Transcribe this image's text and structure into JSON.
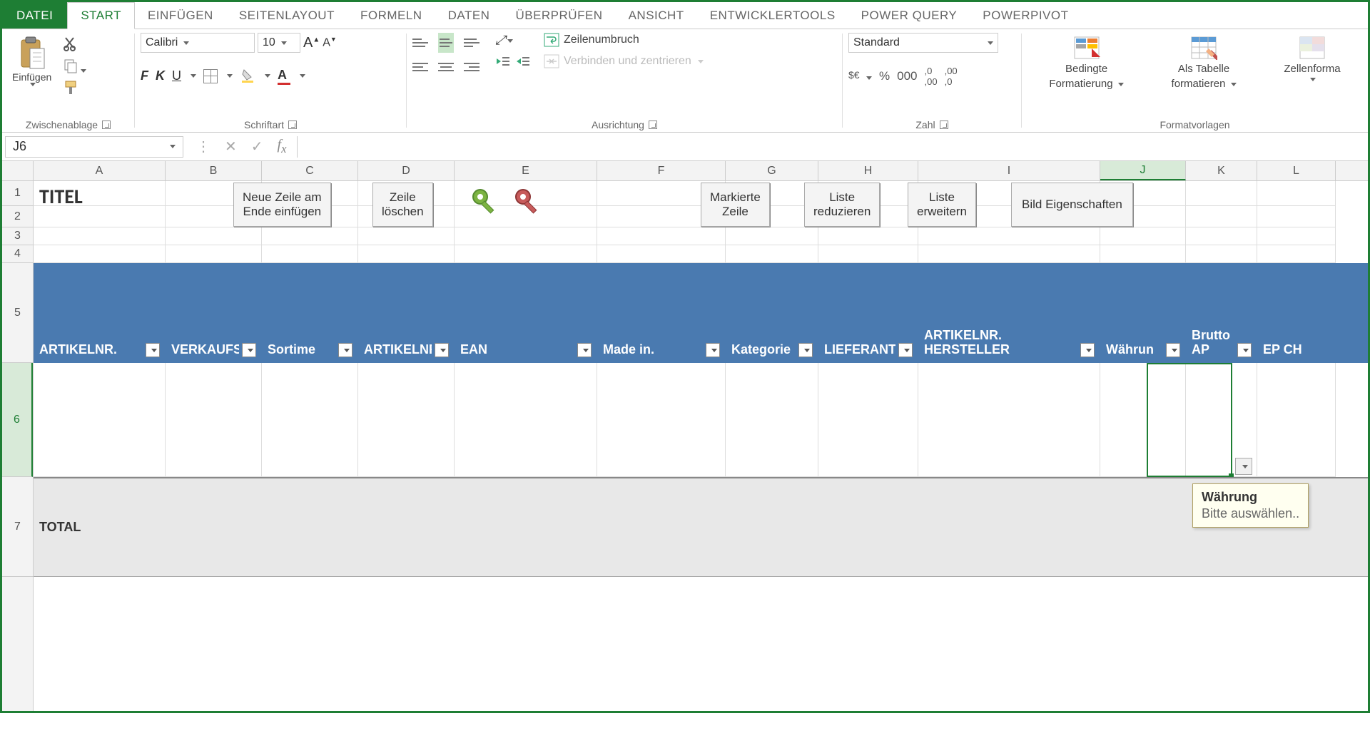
{
  "tabs": {
    "file": "DATEI",
    "start": "START",
    "insert": "EINFÜGEN",
    "layout": "SEITENLAYOUT",
    "formulas": "FORMELN",
    "data": "DATEN",
    "review": "ÜBERPRÜFEN",
    "view": "ANSICHT",
    "dev": "ENTWICKLERTOOLS",
    "pq": "POWER QUERY",
    "pp": "POWERPIVOT"
  },
  "ribbon": {
    "clipboard": {
      "paste": "Einfügen",
      "label": "Zwischenablage"
    },
    "font": {
      "name": "Calibri",
      "size": "10",
      "bold": "F",
      "italic": "K",
      "underline": "U",
      "label": "Schriftart"
    },
    "align": {
      "wrap": "Zeilenumbruch",
      "merge": "Verbinden und zentrieren",
      "label": "Ausrichtung"
    },
    "number": {
      "format": "Standard",
      "label": "Zahl",
      "pct": "%",
      "sep": "000"
    },
    "styles": {
      "cond": "Bedingte",
      "cond2": "Formatierung",
      "table": "Als Tabelle",
      "table2": "formatieren",
      "cell": "Zellenforma",
      "label": "Formatvorlagen"
    }
  },
  "namebox": "J6",
  "colHeaders": [
    "A",
    "B",
    "C",
    "D",
    "E",
    "F",
    "G",
    "H",
    "I",
    "J",
    "K",
    "L"
  ],
  "rows": {
    "r1": "1",
    "r2": "2",
    "r3": "3",
    "r4": "4",
    "r5": "5",
    "r6": "6",
    "r7": "7"
  },
  "sheet": {
    "title": "TITEL",
    "btnNewRow1": "Neue Zeile am",
    "btnNewRow2": "Ende einfügen",
    "btnDelRow1": "Zeile",
    "btnDelRow2": "löschen",
    "btnMark1": "Markierte",
    "btnMark2": "Zeile",
    "btnReduce1": "Liste",
    "btnReduce2": "reduzieren",
    "btnExpand1": "Liste",
    "btnExpand2": "erweitern",
    "btnImg": "Bild Eigenschaften",
    "total": "TOTAL"
  },
  "tableHeaders": {
    "a": "ARTIKELNR.",
    "b": "VERKAUFS",
    "c": "Sortime",
    "d": "ARTIKELNR",
    "e": "EAN",
    "f": "Made in.",
    "g": "Kategorie",
    "h": "LIEFERANT",
    "i1": "ARTIKELNR.",
    "i2": "HERSTELLER",
    "j": "Währun",
    "k1": "Brutto",
    "k2": "AP",
    "l": "EP CH"
  },
  "tooltip": {
    "title": "Währung",
    "body": "Bitte auswählen.."
  }
}
